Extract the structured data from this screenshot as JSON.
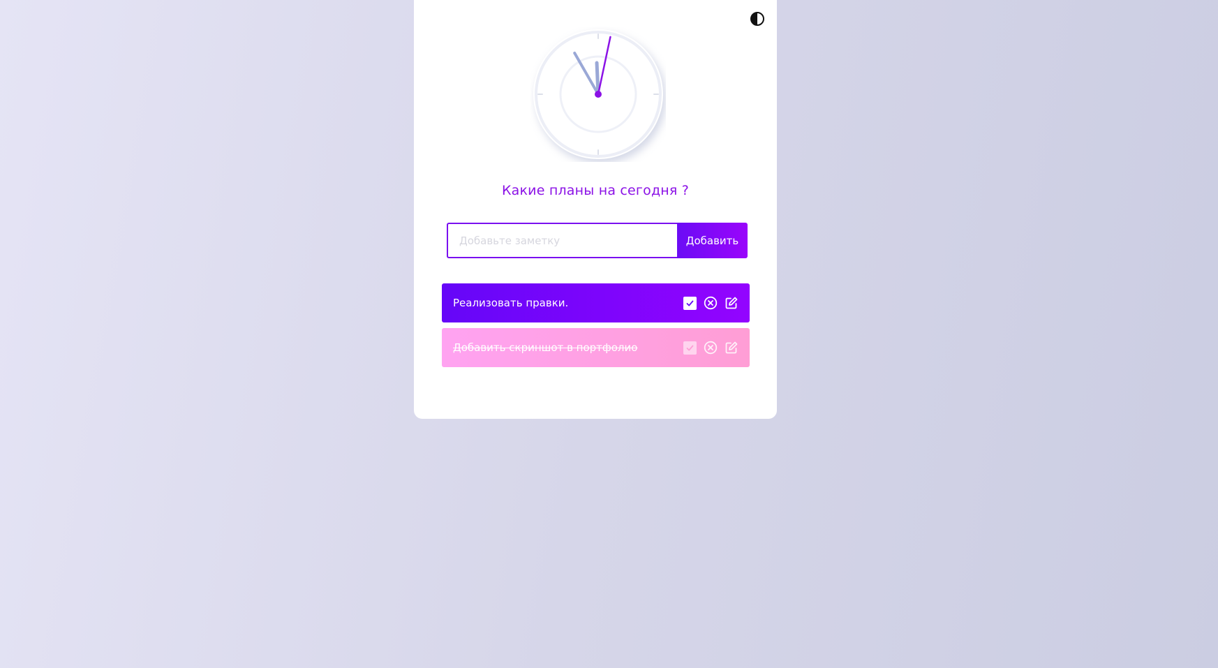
{
  "heading": "Какие планы на сегодня ?",
  "form": {
    "placeholder": "Добавьте заметку",
    "value": "",
    "add_label": "Добавить"
  },
  "clock": {
    "hour": 11,
    "minute": 55,
    "second": 2
  },
  "todos": [
    {
      "text": "Реализовать правки.",
      "done": false
    },
    {
      "text": "Добавить скриншот в портфолио",
      "done": true
    }
  ],
  "colors": {
    "accent": "#8b12e6",
    "primary_gradient_start": "#6506f8",
    "primary_gradient_end": "#9304ff",
    "done_gradient_start": "#ffa3f1",
    "done_gradient_end": "#ff9ed5"
  },
  "icons": {
    "theme": "contrast-icon",
    "complete": "check-icon",
    "delete": "circle-x-icon",
    "edit": "edit-icon"
  }
}
